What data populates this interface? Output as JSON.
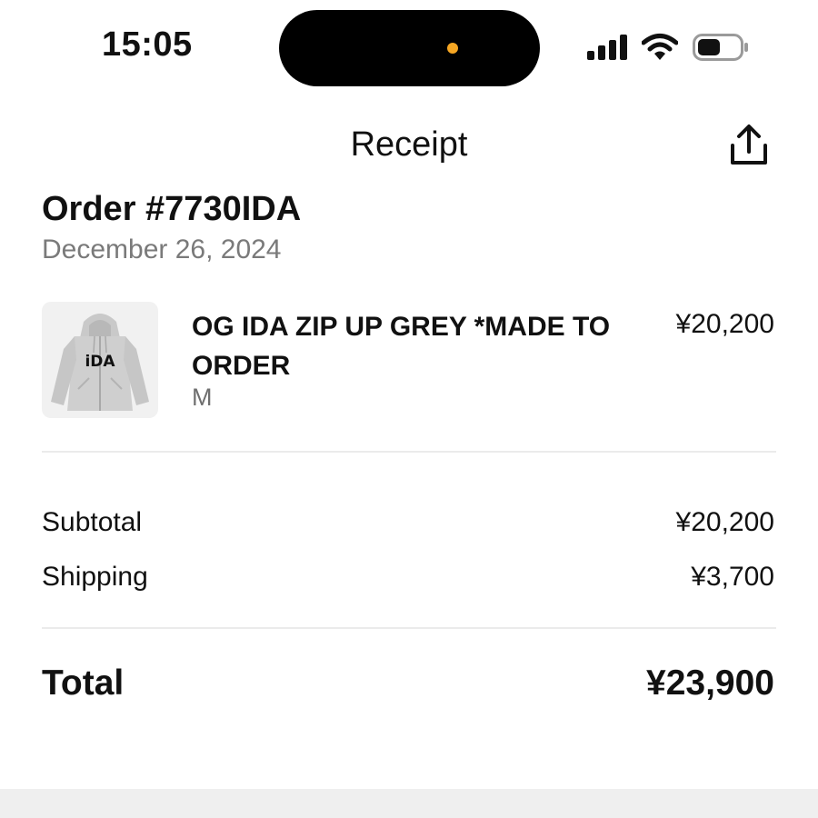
{
  "status_bar": {
    "time": "15:05",
    "signal_icon": "signal-bars-icon",
    "wifi_icon": "wifi-icon",
    "battery_icon": "battery-icon",
    "indicator_color": "#F5A623"
  },
  "header": {
    "title": "Receipt",
    "share_icon": "share-icon"
  },
  "order": {
    "number": "Order #7730IDA",
    "date": "December 26, 2024"
  },
  "items": [
    {
      "name": "OG IDA ZIP UP GREY *MADE TO ORDER",
      "variant": "M",
      "price": "¥20,200",
      "image_logo_text": "iDA"
    }
  ],
  "summary": {
    "subtotal_label": "Subtotal",
    "subtotal_value": "¥20,200",
    "shipping_label": "Shipping",
    "shipping_value": "¥3,700",
    "total_label": "Total",
    "total_value": "¥23,900"
  }
}
